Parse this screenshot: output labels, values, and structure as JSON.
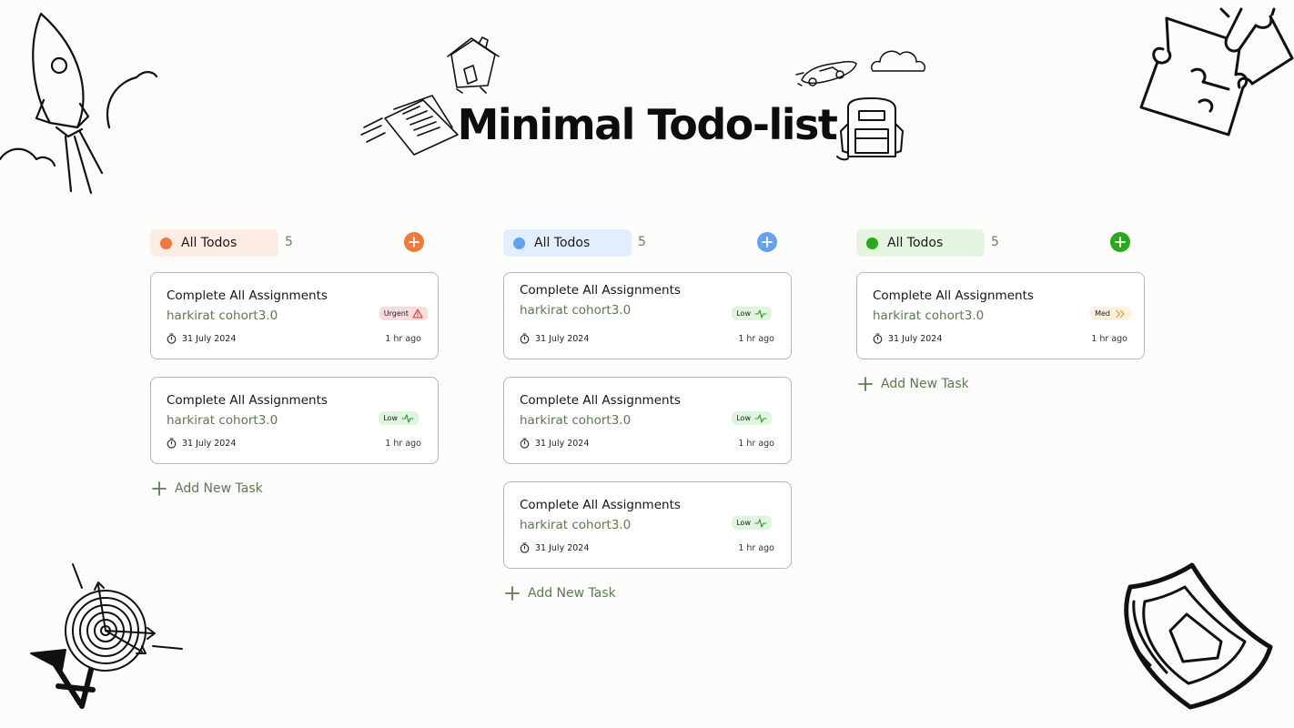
{
  "page": {
    "title": "Minimal Todo-list"
  },
  "colors": {
    "orange": "#ee7a3d",
    "orange_bg": "#fcece3",
    "blue": "#64a1ef",
    "blue_bg": "#e3eefc",
    "green": "#2aa81e",
    "green_bg": "#e4f5e0",
    "subtext": "#5c7a4f"
  },
  "columns": [
    {
      "label": "All Todos",
      "count": "5",
      "accent": "orange",
      "add_task_label": "Add New Task",
      "cards": [
        {
          "title": "Complete All Assignments",
          "subtitle": "harkirat cohort3.0",
          "priority": "Urgent",
          "priority_icon": "warning-icon",
          "date": "31 July 2024",
          "ago": "1 hr ago"
        },
        {
          "title": "Complete All Assignments",
          "subtitle": "harkirat cohort3.0",
          "priority": "Low",
          "priority_icon": "pulse-icon",
          "date": "31 July 2024",
          "ago": "1 hr ago"
        }
      ]
    },
    {
      "label": "All Todos",
      "count": "5",
      "accent": "blue",
      "add_task_label": "Add New Task",
      "cards": [
        {
          "title": "Complete All Assignments",
          "subtitle": "harkirat cohort3.0",
          "priority": "Low",
          "priority_icon": "pulse-icon",
          "date": "31 July 2024",
          "ago": "1 hr ago"
        },
        {
          "title": "Complete All Assignments",
          "subtitle": "harkirat cohort3.0",
          "priority": "Low",
          "priority_icon": "pulse-icon",
          "date": "31 July 2024",
          "ago": "1 hr ago"
        },
        {
          "title": "Complete All Assignments",
          "subtitle": "harkirat cohort3.0",
          "priority": "Low",
          "priority_icon": "pulse-icon",
          "date": "31 July 2024",
          "ago": "1 hr ago"
        }
      ]
    },
    {
      "label": "All Todos",
      "count": "5",
      "accent": "green",
      "add_task_label": "Add New Task",
      "cards": [
        {
          "title": "Complete All Assignments",
          "subtitle": "harkirat cohort3.0",
          "priority": "Med",
          "priority_icon": "double-chevron-right-icon",
          "date": "31 July 2024",
          "ago": "1 hr ago"
        }
      ]
    }
  ],
  "decorations": [
    "rocket-doodle",
    "papers-doodle",
    "house-doodle",
    "car-doodle",
    "cloud-doodle",
    "backpack-doodle",
    "puzzle-doodle",
    "target-doodle",
    "shield-doodle"
  ]
}
